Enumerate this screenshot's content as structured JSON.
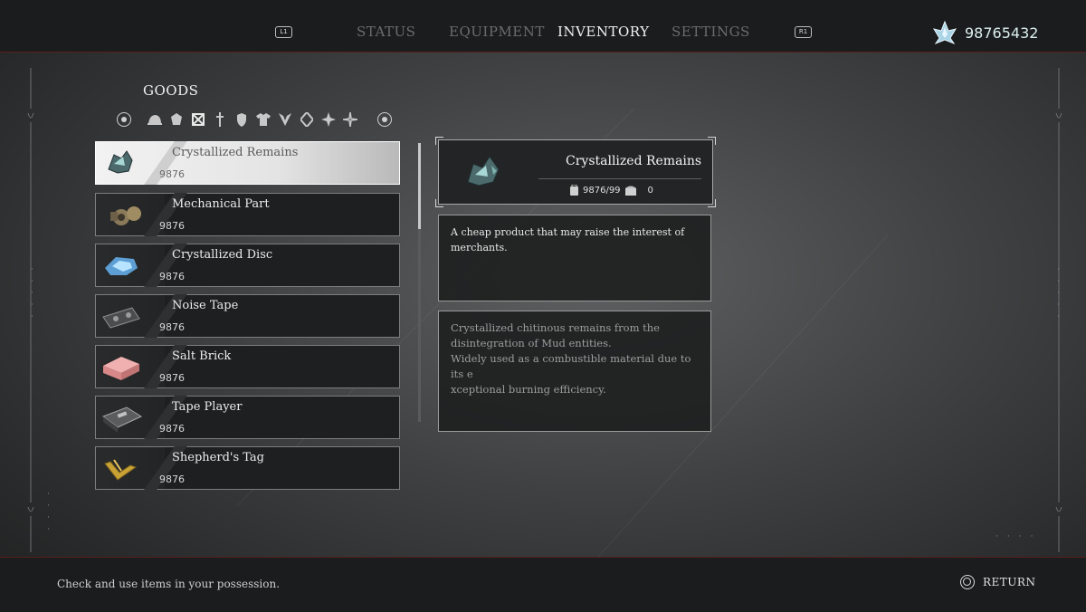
{
  "header": {
    "left_bumper": "L1",
    "right_bumper": "R1",
    "tabs": [
      {
        "label": "STATUS",
        "active": false
      },
      {
        "label": "EQUIPMENT",
        "active": false
      },
      {
        "label": "INVENTORY",
        "active": true
      },
      {
        "label": "SETTINGS",
        "active": false
      }
    ],
    "currency_icon": "crystal-currency-icon",
    "currency_value": "98765432"
  },
  "goods": {
    "title": "GOODS",
    "category_icons": [
      "helmet-icon",
      "gem-icon",
      "crossed-box-icon",
      "dagger-icon",
      "shield-icon",
      "armor-icon",
      "wing-icon",
      "diamond-icon",
      "star-cross-icon",
      "sparkle-icon"
    ],
    "prev_button_icon": "left-stick-icon",
    "next_button_icon": "right-stick-icon"
  },
  "items": [
    {
      "name": "Crystallized Remains",
      "qty": "9876",
      "selected": true,
      "is_new": false,
      "icon": "crystallized-remains-icon"
    },
    {
      "name": "Mechanical Part",
      "qty": "9876",
      "selected": false,
      "is_new": false,
      "icon": "mechanical-part-icon"
    },
    {
      "name": "Crystallized Disc",
      "qty": "9876",
      "selected": false,
      "is_new": false,
      "icon": "crystallized-disc-icon"
    },
    {
      "name": "Noise Tape",
      "qty": "9876",
      "selected": false,
      "is_new": true,
      "icon": "noise-tape-icon"
    },
    {
      "name": "Salt Brick",
      "qty": "9876",
      "selected": false,
      "is_new": true,
      "icon": "salt-brick-icon"
    },
    {
      "name": "Tape Player",
      "qty": "9876",
      "selected": false,
      "is_new": true,
      "icon": "tape-player-icon"
    },
    {
      "name": "Shepherd's Tag",
      "qty": "9876",
      "selected": false,
      "is_new": true,
      "icon": "shepherds-tag-icon"
    }
  ],
  "detail": {
    "name": "Crystallized Remains",
    "held": "9876/99",
    "stored": "0",
    "held_icon": "backpack-icon",
    "stored_icon": "storage-chest-icon",
    "description": "A cheap product that may raise the interest of\nmerchants.",
    "lore": "Crystallized chitinous remains from the\ndisintegration of Mud entities.\nWidely used as a combustible material due to its e\nxceptional burning efficiency."
  },
  "footer": {
    "hint": "Check and use items in your possession.",
    "return_icon": "circle-button-icon",
    "return_label": "RETURN"
  },
  "colors": {
    "accent_red": "#5a1e1e",
    "selected_bg": "#f2f2f2",
    "currency_text": "#dcefef"
  }
}
